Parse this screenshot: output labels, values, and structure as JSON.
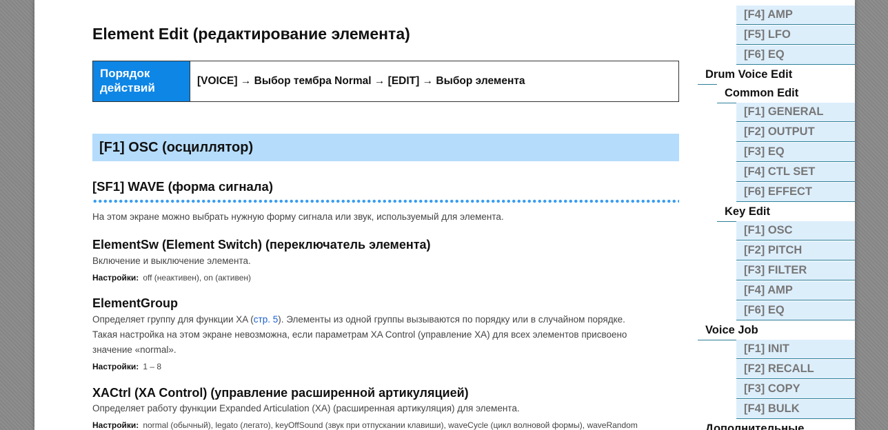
{
  "main": {
    "title": "Element Edit (редактирование элемента)",
    "procedure_label_line1": "Порядок",
    "procedure_label_line2": "действий",
    "procedure_steps": "[VOICE] → Выбор тембра Normal → [EDIT] → Выбор элемента",
    "section_title": "[F1] OSC (осциллятор)",
    "subsection_title": "[SF1] WAVE (форма сигнала)",
    "intro": "На этом экране можно выбрать нужную форму сигнала или звук, используемый для элемента.",
    "settings_label": "Настройки:",
    "params": [
      {
        "name": "ElementSw (Element Switch) (переключатель элемента)",
        "desc": "Включение и выключение элемента.",
        "settings": "off (неактивен), on (активен)"
      },
      {
        "name": "ElementGroup",
        "desc_before": "Определяет группу для функции XA (",
        "desc_link": "стр. 5",
        "desc_after": "). Элементы из одной группы вызываются по порядку или в случайном порядке.",
        "desc_line2": "Такая настройка на этом экране невозможна, если параметрам XA Control (управление XA) для всех элементов присвоено",
        "desc_line3": "значение «normal».",
        "settings": "1 – 8"
      },
      {
        "name": "XACtrl (XA Control) (управление расширенной артикуляцией)",
        "desc": "Определяет работу функции Expanded Articulation (XA) (расширенная артикуляция) для элемента.",
        "settings": "normal (обычный), legato (легато), keyOffSound (звук при отпускании клавиши), waveCycle (цикл волновой формы), waveRandom"
      }
    ]
  },
  "sidebar": {
    "items": [
      {
        "label": "[F4] AMP",
        "level": 3
      },
      {
        "label": "[F5] LFO",
        "level": 3
      },
      {
        "label": "[F6] EQ",
        "level": 3
      },
      {
        "label": "Drum Voice Edit",
        "level": 1
      },
      {
        "label": "Common Edit",
        "level": 2
      },
      {
        "label": "[F1] GENERAL",
        "level": 3
      },
      {
        "label": "[F2] OUTPUT",
        "level": 3
      },
      {
        "label": "[F3] EQ",
        "level": 3
      },
      {
        "label": "[F4] CTL SET",
        "level": 3
      },
      {
        "label": "[F6] EFFECT",
        "level": 3
      },
      {
        "label": "Key Edit",
        "level": 2
      },
      {
        "label": "[F1] OSC",
        "level": 3
      },
      {
        "label": "[F2] PITCH",
        "level": 3
      },
      {
        "label": "[F3] FILTER",
        "level": 3
      },
      {
        "label": "[F4] AMP",
        "level": 3
      },
      {
        "label": "[F6] EQ",
        "level": 3
      },
      {
        "label": "Voice Job",
        "level": 1
      },
      {
        "label": "[F1] INIT",
        "level": 3
      },
      {
        "label": "[F2] RECALL",
        "level": 3
      },
      {
        "label": "[F3] COPY",
        "level": 3
      },
      {
        "label": "[F4] BULK",
        "level": 3
      },
      {
        "label": "Дополнительные",
        "level": 1
      }
    ]
  }
}
